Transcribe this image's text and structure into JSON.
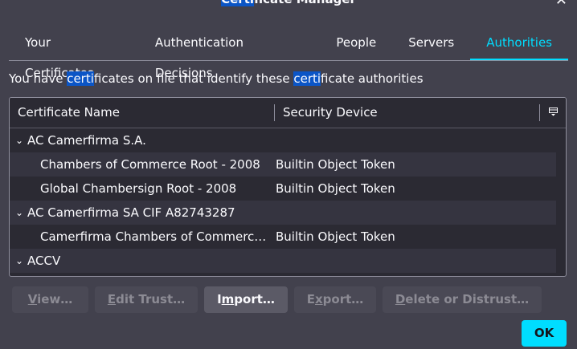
{
  "window": {
    "title": "Certificate Manager"
  },
  "tabs": [
    {
      "label": "Your Certificates",
      "selected": false
    },
    {
      "label": "Authentication Decisions",
      "selected": false
    },
    {
      "label": "People",
      "selected": false
    },
    {
      "label": "Servers",
      "selected": false
    },
    {
      "label": "Authorities",
      "selected": true
    }
  ],
  "description": {
    "part1": "You have ",
    "hl1": "certi",
    "part2": "ficates on file that identify these ",
    "hl2": "certi",
    "part3": "ficate authorities"
  },
  "table": {
    "columns": {
      "name": "Certificate Name",
      "device": "Security Device"
    },
    "rows": [
      {
        "type": "group",
        "name": "AC Camerfirma S.A.",
        "device": ""
      },
      {
        "type": "item",
        "name": "Chambers of Commerce Root - 2008",
        "device": "Builtin Object Token"
      },
      {
        "type": "item",
        "name": "Global Chambersign Root - 2008",
        "device": "Builtin Object Token"
      },
      {
        "type": "group",
        "name": "AC Camerfirma SA CIF A82743287",
        "device": ""
      },
      {
        "type": "item",
        "name": "Camerfirma Chambers of Commerce Root",
        "device": "Builtin Object Token"
      },
      {
        "type": "group",
        "name": "ACCV",
        "device": ""
      }
    ]
  },
  "buttons": {
    "view": {
      "accel": "V",
      "rest": "iew…"
    },
    "edit_trust": {
      "accel": "E",
      "rest": "dit Trust…"
    },
    "import": {
      "pre": "I",
      "accel": "m",
      "rest": "port…"
    },
    "export": {
      "pre": "E",
      "accel": "x",
      "rest": "port…"
    },
    "delete": {
      "accel": "D",
      "rest": "elete or Distrust…"
    },
    "ok": "OK"
  },
  "colors": {
    "accent": "#00ddff",
    "highlight": "#0b55c6",
    "background": "#42414d"
  }
}
